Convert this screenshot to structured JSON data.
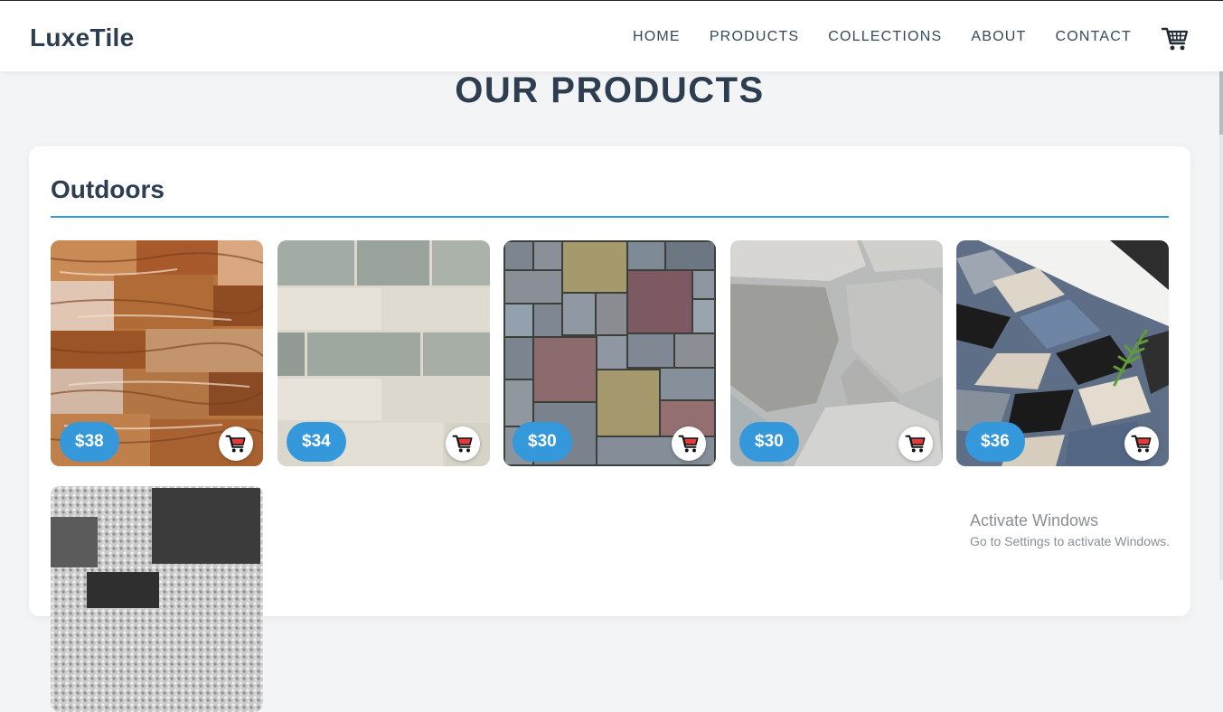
{
  "brand": "LuxeTile",
  "nav": [
    "HOME",
    "PRODUCTS",
    "COLLECTIONS",
    "ABOUT",
    "CONTACT"
  ],
  "cart": {
    "count": "0",
    "icon": "shopping-cart-icon"
  },
  "page_title": "OUR PRODUCTS",
  "section": {
    "title": "Outdoors",
    "products": [
      {
        "price": "$38",
        "texture": "rust travertine stone cladding"
      },
      {
        "price": "$34",
        "texture": "grey and cream brick pavers"
      },
      {
        "price": "$30",
        "texture": "multicolor granite pavers"
      },
      {
        "price": "$30",
        "texture": "grey flagstone"
      },
      {
        "price": "$36",
        "texture": "blue black beige tiles with fern"
      },
      {
        "price": "",
        "texture": "black slabs on white gravel"
      }
    ]
  },
  "watermark": {
    "title": "Activate Windows",
    "subtitle": "Go to Settings to activate Windows."
  },
  "colors": {
    "accent": "#3498db",
    "heading": "#2c3e50",
    "background": "#f3f4f6"
  }
}
